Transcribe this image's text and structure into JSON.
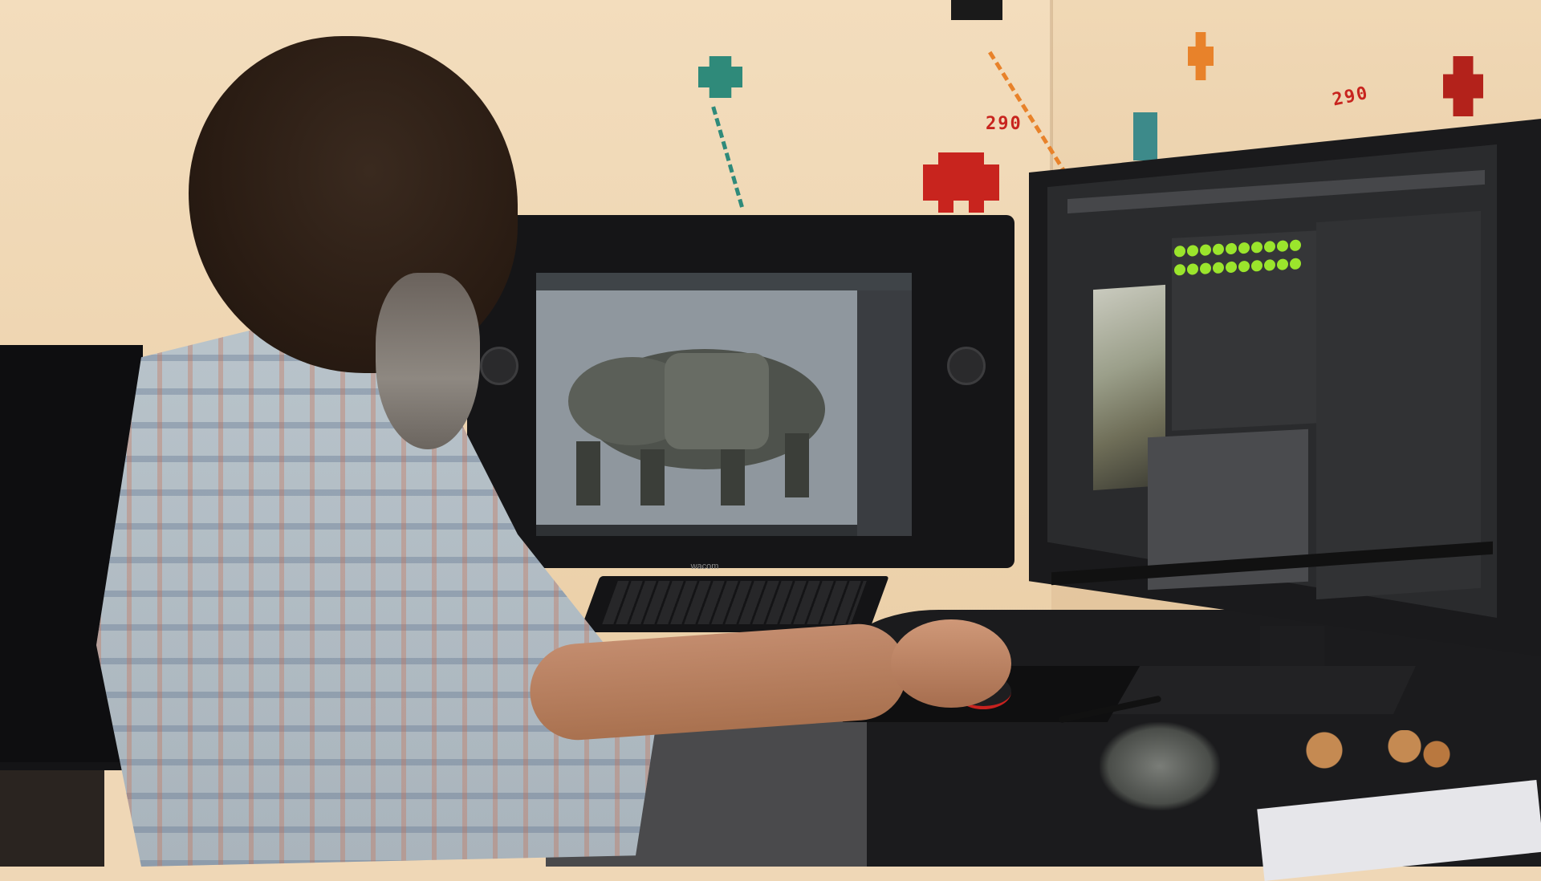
{
  "scene": {
    "description_tags": [
      "artist",
      "workstation",
      "3d-modeling"
    ],
    "wall_scores": [
      "290",
      "290"
    ],
    "wacom_brand": "wacom"
  },
  "colors": {
    "wall": "#f3ddbd",
    "invader_red": "#c8241e",
    "invader_teal": "#2f8a7a",
    "invader_orange": "#e8822a",
    "timeline_green": "#9be52c",
    "desk": "#1b1b1d"
  },
  "apps": {
    "left_screen_app": "3d-viewport",
    "right_screen_app": "image-editor"
  }
}
